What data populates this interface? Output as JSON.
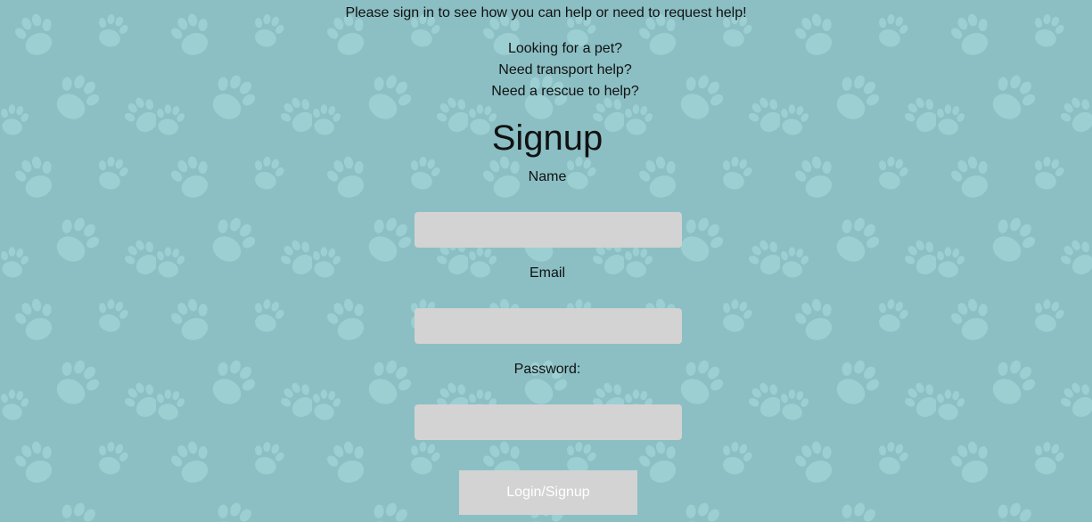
{
  "intro": {
    "signin_prompt": "Please sign in to see how you can help or need to request help!",
    "lines": [
      "Looking for a pet?",
      "Need transport help?",
      "Need a rescue to help?"
    ]
  },
  "form": {
    "title": "Signup",
    "name_label": "Name",
    "name_value": "",
    "email_label": "Email",
    "email_value": "",
    "password_label": "Password:",
    "password_value": "",
    "submit_label": "Login/Signup"
  },
  "theme": {
    "background": "#8bbfc4",
    "paw_color": "#9ccfd2",
    "input_background": "#d3d3d3",
    "button_text": "#ffffff",
    "background_icon": "paw-print-icon"
  }
}
